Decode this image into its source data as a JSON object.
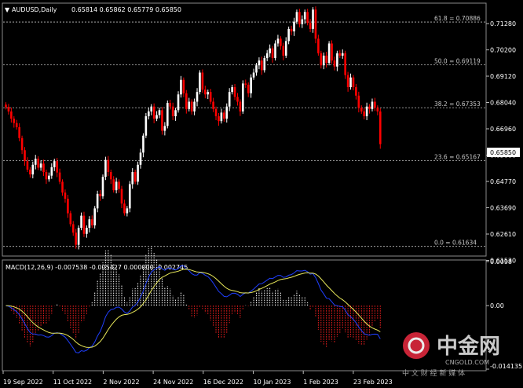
{
  "window": {
    "symbol_label": "AUDUSD,Daily",
    "ohlc_values": "0.65814 0.65862 0.65779 0.65850",
    "collapse_glyph": "▼"
  },
  "macd_header": "MACD(12,26,9) -0.007538 -0.005427 0.000000 -0.002745",
  "current_price": "0.65850",
  "price_axis": {
    "labels": [
      "0.71280",
      "0.70200",
      "0.69120",
      "0.68040",
      "0.66960",
      "0.65880",
      "0.64770",
      "0.63690",
      "0.62610",
      "0.61530"
    ],
    "ylim": [
      0.613,
      0.716
    ]
  },
  "macd_axis": {
    "labels": [
      "0.0098",
      "0.00",
      "-0.014135"
    ]
  },
  "fib_levels": [
    {
      "label": "61.8 = 0.70886",
      "value": 0.70886
    },
    {
      "label": "50.0 = 0.69119",
      "value": 0.69119
    },
    {
      "label": "38.2 = 0.67353",
      "value": 0.67353
    },
    {
      "label": "23.6 = 0.65167",
      "value": 0.65167
    },
    {
      "label": "0.0 = 0.61634",
      "value": 0.61634
    }
  ],
  "date_labels": [
    "19 Sep 2022",
    "11 Oct 2022",
    "2 Nov 2022",
    "24 Nov 2022",
    "16 Dec 2022",
    "10 Jan 2023",
    "1 Feb 2023",
    "23 Feb 2023"
  ],
  "watermark": {
    "brand": "中金网",
    "domain": "CNGOLD.COM",
    "tagline": "中 文 财 经 新 媒 体"
  },
  "colors": {
    "bull": "#ffffff",
    "bear": "#ff0000",
    "grid": "#c0c0c0",
    "macd_line": "#1f3fff",
    "signal_line": "#e8e85a",
    "brand": "#d9283c"
  },
  "chart_data": {
    "type": "candlestick",
    "closes": [
      0.6738,
      0.672,
      0.669,
      0.6672,
      0.6655,
      0.661,
      0.656,
      0.6515,
      0.648,
      0.646,
      0.65,
      0.6525,
      0.6488,
      0.6505,
      0.647,
      0.644,
      0.6455,
      0.649,
      0.6515,
      0.6468,
      0.643,
      0.6385,
      0.636,
      0.63,
      0.6255,
      0.622,
      0.617,
      0.624,
      0.629,
      0.6215,
      0.624,
      0.6275,
      0.625,
      0.632,
      0.638,
      0.637,
      0.645,
      0.652,
      0.647,
      0.644,
      0.6395,
      0.643,
      0.64,
      0.634,
      0.63,
      0.632,
      0.642,
      0.647,
      0.643,
      0.65,
      0.655,
      0.662,
      0.67,
      0.672,
      0.674,
      0.669,
      0.6705,
      0.6725,
      0.664,
      0.666,
      0.6755,
      0.674,
      0.67,
      0.6725,
      0.679,
      0.685,
      0.6795,
      0.673,
      0.676,
      0.672,
      0.676,
      0.68,
      0.688,
      0.681,
      0.679,
      0.68,
      0.676,
      0.673,
      0.67,
      0.668,
      0.6715,
      0.669,
      0.674,
      0.68,
      0.682,
      0.678,
      0.676,
      0.672,
      0.6835,
      0.683,
      0.6795,
      0.686,
      0.688,
      0.691,
      0.693,
      0.689,
      0.694,
      0.696,
      0.698,
      0.694,
      0.7,
      0.702,
      0.699,
      0.695,
      0.701,
      0.706,
      0.705,
      0.709,
      0.713,
      0.708,
      0.71,
      0.713,
      0.7085,
      0.706,
      0.714,
      0.702,
      0.696,
      0.691,
      0.695,
      0.692,
      0.7,
      0.693,
      0.6905,
      0.696,
      0.695,
      0.696,
      0.687,
      0.682,
      0.686,
      0.682,
      0.6785,
      0.6735,
      0.672,
      0.67,
      0.674,
      0.673,
      0.676,
      0.6735,
      0.672,
      0.6585
    ],
    "fib_retracement": [
      0.70886,
      0.69119,
      0.67353,
      0.65167,
      0.61634
    ],
    "x_tick_labels": [
      "19 Sep 2022",
      "11 Oct 2022",
      "2 Nov 2022",
      "24 Nov 2022",
      "16 Dec 2022",
      "10 Jan 2023",
      "1 Feb 2023",
      "23 Feb 2023"
    ],
    "y_tick_labels": [
      "0.71280",
      "0.70200",
      "0.69120",
      "0.68040",
      "0.66960",
      "0.65880",
      "0.64770",
      "0.63690",
      "0.62610",
      "0.61530"
    ],
    "ylim": [
      0.613,
      0.716
    ],
    "macd_ylim": [
      -0.014135,
      0.0098
    ]
  }
}
